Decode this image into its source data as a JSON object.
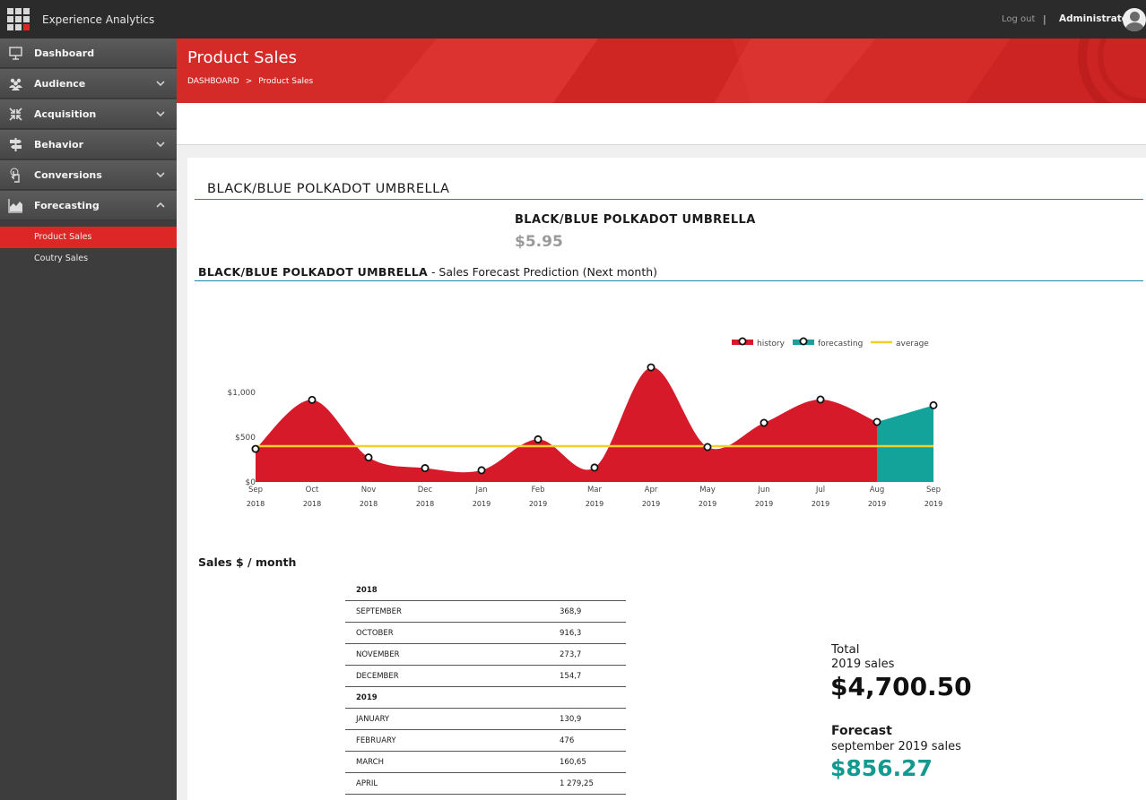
{
  "app": {
    "title": "Experience Analytics",
    "logout_label": "Log out",
    "separator": "|",
    "user_name": "Administrator"
  },
  "sidebar": {
    "items": [
      {
        "label": "Dashboard",
        "icon": "presentation-icon"
      },
      {
        "label": "Audience",
        "icon": "people-icon"
      },
      {
        "label": "Acquisition",
        "icon": "arrows-inward-icon"
      },
      {
        "label": "Behavior",
        "icon": "signpost-icon"
      },
      {
        "label": "Conversions",
        "icon": "touch-hand-icon"
      },
      {
        "label": "Forecasting",
        "icon": "area-chart-icon"
      }
    ],
    "sub_items": [
      {
        "label": "Product Sales",
        "active": true
      },
      {
        "label": "Coutry Sales",
        "active": false
      }
    ]
  },
  "banner": {
    "title": "Product Sales",
    "breadcrumb": [
      "DASHBOARD",
      "Product Sales"
    ],
    "breadcrumb_sep": ">"
  },
  "product": {
    "heading": "BLACK/BLUE POLKADOT UMBRELLA",
    "name": "BLACK/BLUE POLKADOT UMBRELLA",
    "price": "$5.95",
    "forecast_title_bold": "BLACK/BLUE POLKADOT UMBRELLA",
    "forecast_title_rest": " - Sales Forecast Prediction (Next month)"
  },
  "chart_data": {
    "type": "area",
    "x_labels": [
      [
        "Sep",
        "2018"
      ],
      [
        "Oct",
        "2018"
      ],
      [
        "Nov",
        "2018"
      ],
      [
        "Dec",
        "2018"
      ],
      [
        "Jan",
        "2019"
      ],
      [
        "Feb",
        "2019"
      ],
      [
        "Mar",
        "2019"
      ],
      [
        "Apr",
        "2019"
      ],
      [
        "May",
        "2019"
      ],
      [
        "Jun",
        "2019"
      ],
      [
        "Jul",
        "2019"
      ],
      [
        "Aug",
        "2019"
      ],
      [
        "Sep",
        "2019"
      ]
    ],
    "series": [
      {
        "name": "history",
        "color": "#d71a2a",
        "values": [
          368.9,
          916.3,
          273.7,
          154.7,
          130.9,
          476,
          160.65,
          1279.25,
          390,
          660,
          920,
          670,
          null
        ]
      },
      {
        "name": "forecasting",
        "color": "#13a39a",
        "values": [
          null,
          null,
          null,
          null,
          null,
          null,
          null,
          null,
          null,
          null,
          null,
          670,
          856.27
        ]
      },
      {
        "name": "average",
        "color": "#f4cf2a",
        "values": [
          400,
          400,
          400,
          400,
          400,
          400,
          400,
          400,
          400,
          400,
          400,
          400,
          400
        ]
      }
    ],
    "y_ticks": [
      "$0",
      "$500",
      "$1,000"
    ],
    "y_tick_values": [
      0,
      500,
      1000
    ],
    "ylim": [
      0,
      1300
    ],
    "legend": "top-right",
    "grid": false
  },
  "sales": {
    "title": "Sales $ / month",
    "rows": [
      {
        "type": "year",
        "label": "2018",
        "value": ""
      },
      {
        "type": "month",
        "label": "SEPTEMBER",
        "value": "368,9"
      },
      {
        "type": "month",
        "label": "OCTOBER",
        "value": "916,3"
      },
      {
        "type": "month",
        "label": "NOVEMBER",
        "value": "273,7"
      },
      {
        "type": "month",
        "label": "DECEMBER",
        "value": "154,7"
      },
      {
        "type": "year",
        "label": "2019",
        "value": ""
      },
      {
        "type": "month",
        "label": "JANUARY",
        "value": "130,9"
      },
      {
        "type": "month",
        "label": "FEBRUARY",
        "value": "476"
      },
      {
        "type": "month",
        "label": "MARCH",
        "value": "160,65"
      },
      {
        "type": "month",
        "label": "APRIL",
        "value": "1 279,25"
      }
    ]
  },
  "summary": {
    "total_label": "Total",
    "total_sub": "2019 sales",
    "total_value": "$4,700.50",
    "forecast_label": "Forecast",
    "forecast_sub": "september 2019 sales",
    "forecast_value": "$856.27"
  }
}
